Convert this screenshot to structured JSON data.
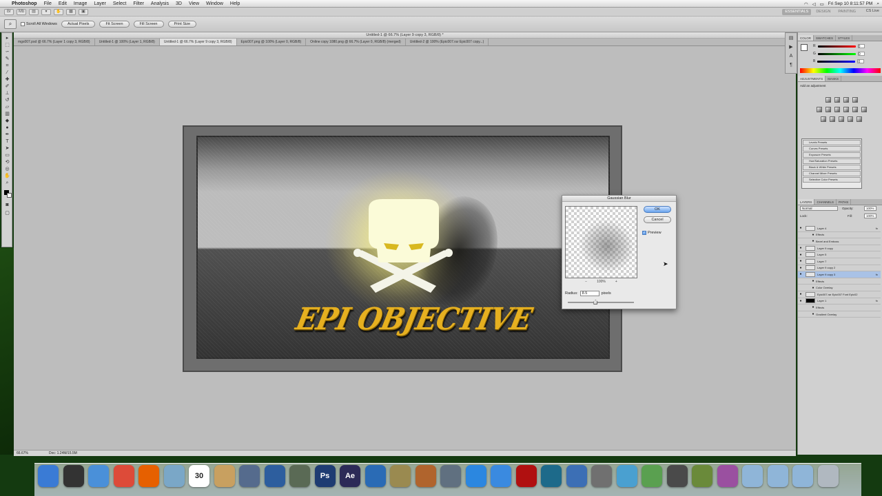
{
  "menubar": {
    "apple": "",
    "app_name": "Photoshop",
    "items": [
      "File",
      "Edit",
      "Image",
      "Layer",
      "Select",
      "Filter",
      "Analysis",
      "3D",
      "View",
      "Window",
      "Help"
    ],
    "clock": "Fri Sep 10  8:11:57 PM"
  },
  "appbar": {
    "workspace_buttons": [
      "ESSENTIALS",
      "DESIGN",
      "PAINTING"
    ],
    "cs_live": "CS Live"
  },
  "optionsbar": {
    "scroll_all_windows": "Scroll All Windows",
    "buttons": [
      "Actual Pixels",
      "Fit Screen",
      "Fill Screen",
      "Print Size"
    ]
  },
  "document": {
    "title": "Untitled-1 @ 66.7% (Layer 9 copy 3, RGB/8) *",
    "tabs": [
      "mgs007.psd @ 66.7% (Layer 1 copy 3, RGB/8)",
      "Untitled-1 @ 100% (Layer 1, RGB/8)",
      "Untitled-1 @ 66.7% (Layer 9 copy 3, RGB/8)",
      "Epic007.png @ 100% (Layer 0, RGB/8)",
      "Online copy 1080.png @ 66.7% (Layer 0, RGB/8) (merged)",
      "Untitled-2 @ 100% (Epic007.rar Epic007 copy...)"
    ],
    "status_zoom": "66.67%",
    "status_doc": "Doc: 1.24M/15.5M",
    "artwork_text": "EPI OBJECTIVE"
  },
  "gaussian_blur": {
    "title": "Gaussian Blur",
    "ok": "OK",
    "cancel": "Cancel",
    "preview_label": "Preview",
    "preview_checked": true,
    "zoom_minus": "−",
    "zoom_value": "100%",
    "zoom_plus": "+",
    "radius_label": "Radius:",
    "radius_value": "8.5",
    "radius_unit": "pixels",
    "radius_slider_fraction": 0.42
  },
  "panels": {
    "color_tabs": [
      "COLOR",
      "SWATCHES",
      "STYLES"
    ],
    "color_channels": [
      {
        "label": "R",
        "value": "0"
      },
      {
        "label": "G",
        "value": "0"
      },
      {
        "label": "B",
        "value": "0"
      }
    ],
    "adjust_tabs": [
      "ADJUSTMENTS",
      "MASKS"
    ],
    "adjust_hint": "Add an adjustment",
    "presets": [
      "Levels Presets",
      "Curves Presets",
      "Exposure Presets",
      "Hue/Saturation Presets",
      "Black & White Presets",
      "Channel Mixer Presets",
      "Selective Color Presets"
    ],
    "layer_tabs": [
      "LAYERS",
      "CHANNELS",
      "PATHS"
    ],
    "blend_mode": "Normal",
    "opacity_label": "Opacity:",
    "opacity_value": "100%",
    "lock_label": "Lock:",
    "fill_label": "Fill:",
    "fill_value": "100%",
    "layers": [
      {
        "name": "Layer 4",
        "type": "layer",
        "fx": true,
        "selected": false
      },
      {
        "name": "Effects",
        "type": "effects",
        "fx": false,
        "selected": false
      },
      {
        "name": "Bevel and Emboss",
        "type": "effect",
        "fx": false,
        "selected": false
      },
      {
        "name": "Layer 9 copy",
        "type": "layer",
        "fx": false,
        "selected": false
      },
      {
        "name": "Layer 5",
        "type": "layer",
        "fx": false,
        "selected": false
      },
      {
        "name": "Layer 7",
        "type": "layer",
        "fx": false,
        "selected": false
      },
      {
        "name": "Layer 9 copy 2",
        "type": "layer",
        "fx": false,
        "selected": false
      },
      {
        "name": "Layer 9 copy 3",
        "type": "layer",
        "fx": true,
        "selected": true
      },
      {
        "name": "Effects",
        "type": "effects",
        "fx": false,
        "selected": false
      },
      {
        "name": "Color Overlay",
        "type": "effect",
        "fx": false,
        "selected": false
      },
      {
        "name": "Epic007.rar Epic007 Font Epic02",
        "type": "layer",
        "fx": false,
        "selected": false
      },
      {
        "name": "Layer 1",
        "type": "layer",
        "fx": true,
        "selected": false
      },
      {
        "name": "Effects",
        "type": "effects",
        "fx": false,
        "selected": false
      },
      {
        "name": "Gradient Overlay",
        "type": "effect",
        "fx": false,
        "selected": false
      }
    ]
  },
  "dock": {
    "icons": [
      {
        "name": "finder-icon",
        "label": "",
        "color": "#3a7bd5"
      },
      {
        "name": "dashboard-icon",
        "label": "",
        "color": "#333333"
      },
      {
        "name": "safari-icon",
        "label": "",
        "color": "#4a90d9"
      },
      {
        "name": "chrome-icon",
        "label": "",
        "color": "#dd4b39"
      },
      {
        "name": "firefox-icon",
        "label": "",
        "color": "#e66000"
      },
      {
        "name": "preview-icon",
        "label": "",
        "color": "#7aa7c7"
      },
      {
        "name": "ical-icon",
        "label": "30",
        "color": "#ffffff"
      },
      {
        "name": "notes-icon",
        "label": "",
        "color": "#c8a060"
      },
      {
        "name": "iphoto-icon",
        "label": "",
        "color": "#556b8d"
      },
      {
        "name": "imovie-icon",
        "label": "",
        "color": "#2d5e9e"
      },
      {
        "name": "star-icon",
        "label": "",
        "color": "#5a6a55"
      },
      {
        "name": "photoshop-icon",
        "label": "Ps",
        "color": "#1e3c72"
      },
      {
        "name": "after-effects-icon",
        "label": "Ae",
        "color": "#2c2a57"
      },
      {
        "name": "blender-icon",
        "label": "",
        "color": "#2a6bb5"
      },
      {
        "name": "image-capture-icon",
        "label": "",
        "color": "#9a8a50"
      },
      {
        "name": "garageband-icon",
        "label": "",
        "color": "#b0642d"
      },
      {
        "name": "facetime-icon",
        "label": "",
        "color": "#607080"
      },
      {
        "name": "itunes-icon",
        "label": "",
        "color": "#2b87e0"
      },
      {
        "name": "app-store-icon",
        "label": "",
        "color": "#3a8ae0"
      },
      {
        "name": "acrobat-icon",
        "label": "",
        "color": "#b01010"
      },
      {
        "name": "time-machine-icon",
        "label": "",
        "color": "#1d6a8a"
      },
      {
        "name": "download-icon",
        "label": "",
        "color": "#3c6fb5"
      },
      {
        "name": "system-prefs-icon",
        "label": "",
        "color": "#707070"
      },
      {
        "name": "ibooks-icon",
        "label": "",
        "color": "#4aa0d0"
      },
      {
        "name": "photo-icon",
        "label": "",
        "color": "#5aa050"
      },
      {
        "name": "steam-icon",
        "label": "",
        "color": "#4a4a4a"
      },
      {
        "name": "minecraft-icon",
        "label": "",
        "color": "#6a8a3a"
      },
      {
        "name": "photo-booth-icon",
        "label": "",
        "color": "#9a50a0"
      },
      {
        "name": "applications-folder-icon",
        "label": "",
        "color": "#8fb5d8"
      },
      {
        "name": "documents-folder-icon",
        "label": "",
        "color": "#8fb5d8"
      },
      {
        "name": "downloads-folder-icon",
        "label": "",
        "color": "#8fb5d8"
      },
      {
        "name": "trash-icon",
        "label": "",
        "color": "#b0b8c0"
      }
    ]
  }
}
